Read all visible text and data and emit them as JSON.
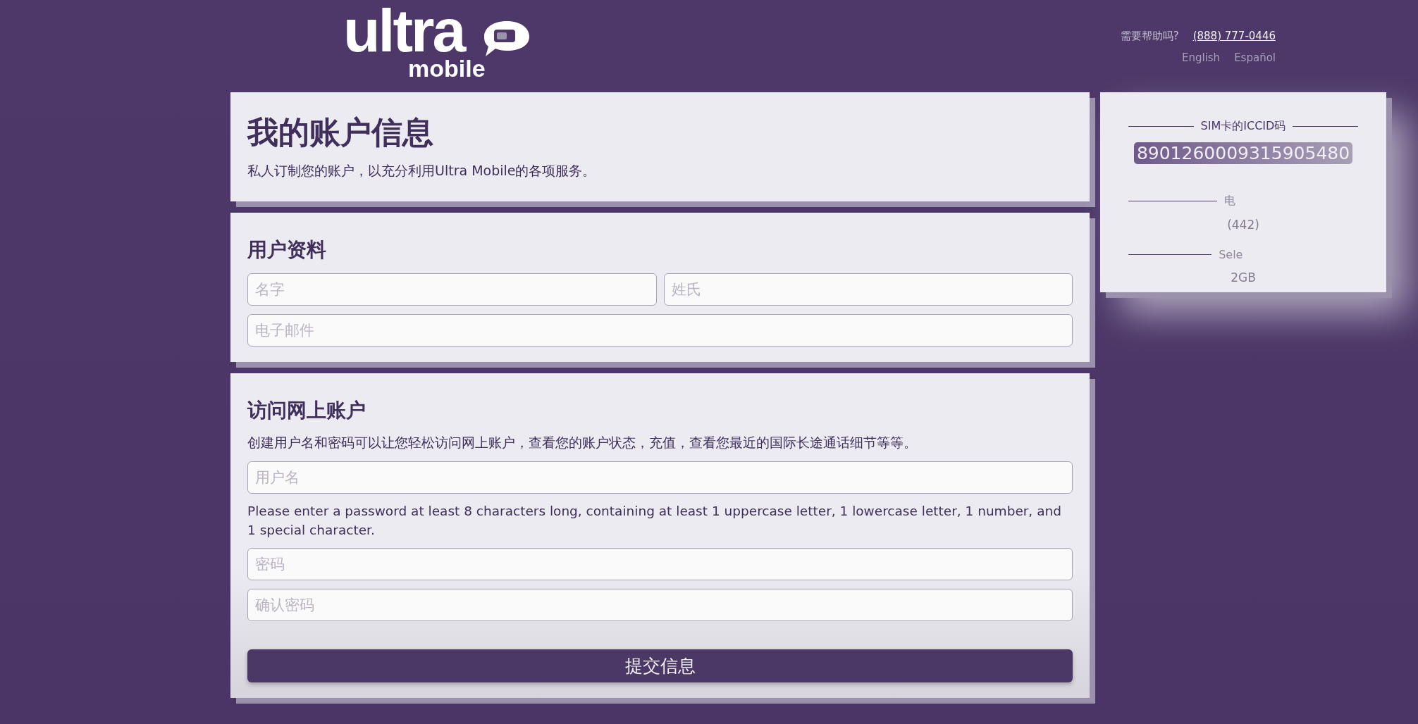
{
  "header": {
    "logo": {
      "top": "ultra",
      "bottom": "mobile"
    },
    "help": {
      "label": "需要帮助吗?",
      "phone": "(888) 777-0446"
    },
    "languages": [
      {
        "label": "English"
      },
      {
        "label": "Español"
      }
    ]
  },
  "account_card": {
    "title": "我的账户信息",
    "subtitle": "私人订制您的账户，以充分利用Ultra Mobile的各项服务。"
  },
  "profile": {
    "title": "用户资料",
    "fields": [
      {
        "placeholder": "名字"
      },
      {
        "placeholder": "姓氏"
      },
      {
        "placeholder": "电子邮件"
      }
    ]
  },
  "online_access": {
    "title": "访问网上账户",
    "description": "创建用户名和密码可以让您轻松访问网上账户，查看您的账户状态，充值，查看您最近的国际长途通话细节等等。",
    "username": {
      "placeholder": "用户名"
    },
    "password_hint": "Please enter a password at least 8 characters long, containing at least 1 uppercase letter, 1 lowercase letter, 1 number, and 1 special character.",
    "passwords": [
      {
        "placeholder": "密码"
      },
      {
        "placeholder": "确认密码"
      }
    ],
    "submit": "提交信息"
  },
  "sim_panel": {
    "sections": [
      {
        "kind": "clear",
        "label": "SIM卡的ICCID码",
        "value": "8901260009315905480"
      },
      {
        "kind": "faded",
        "label": "电",
        "value": "(442)"
      },
      {
        "kind": "faded",
        "label": "Sele",
        "value": "2GB"
      }
    ]
  }
}
